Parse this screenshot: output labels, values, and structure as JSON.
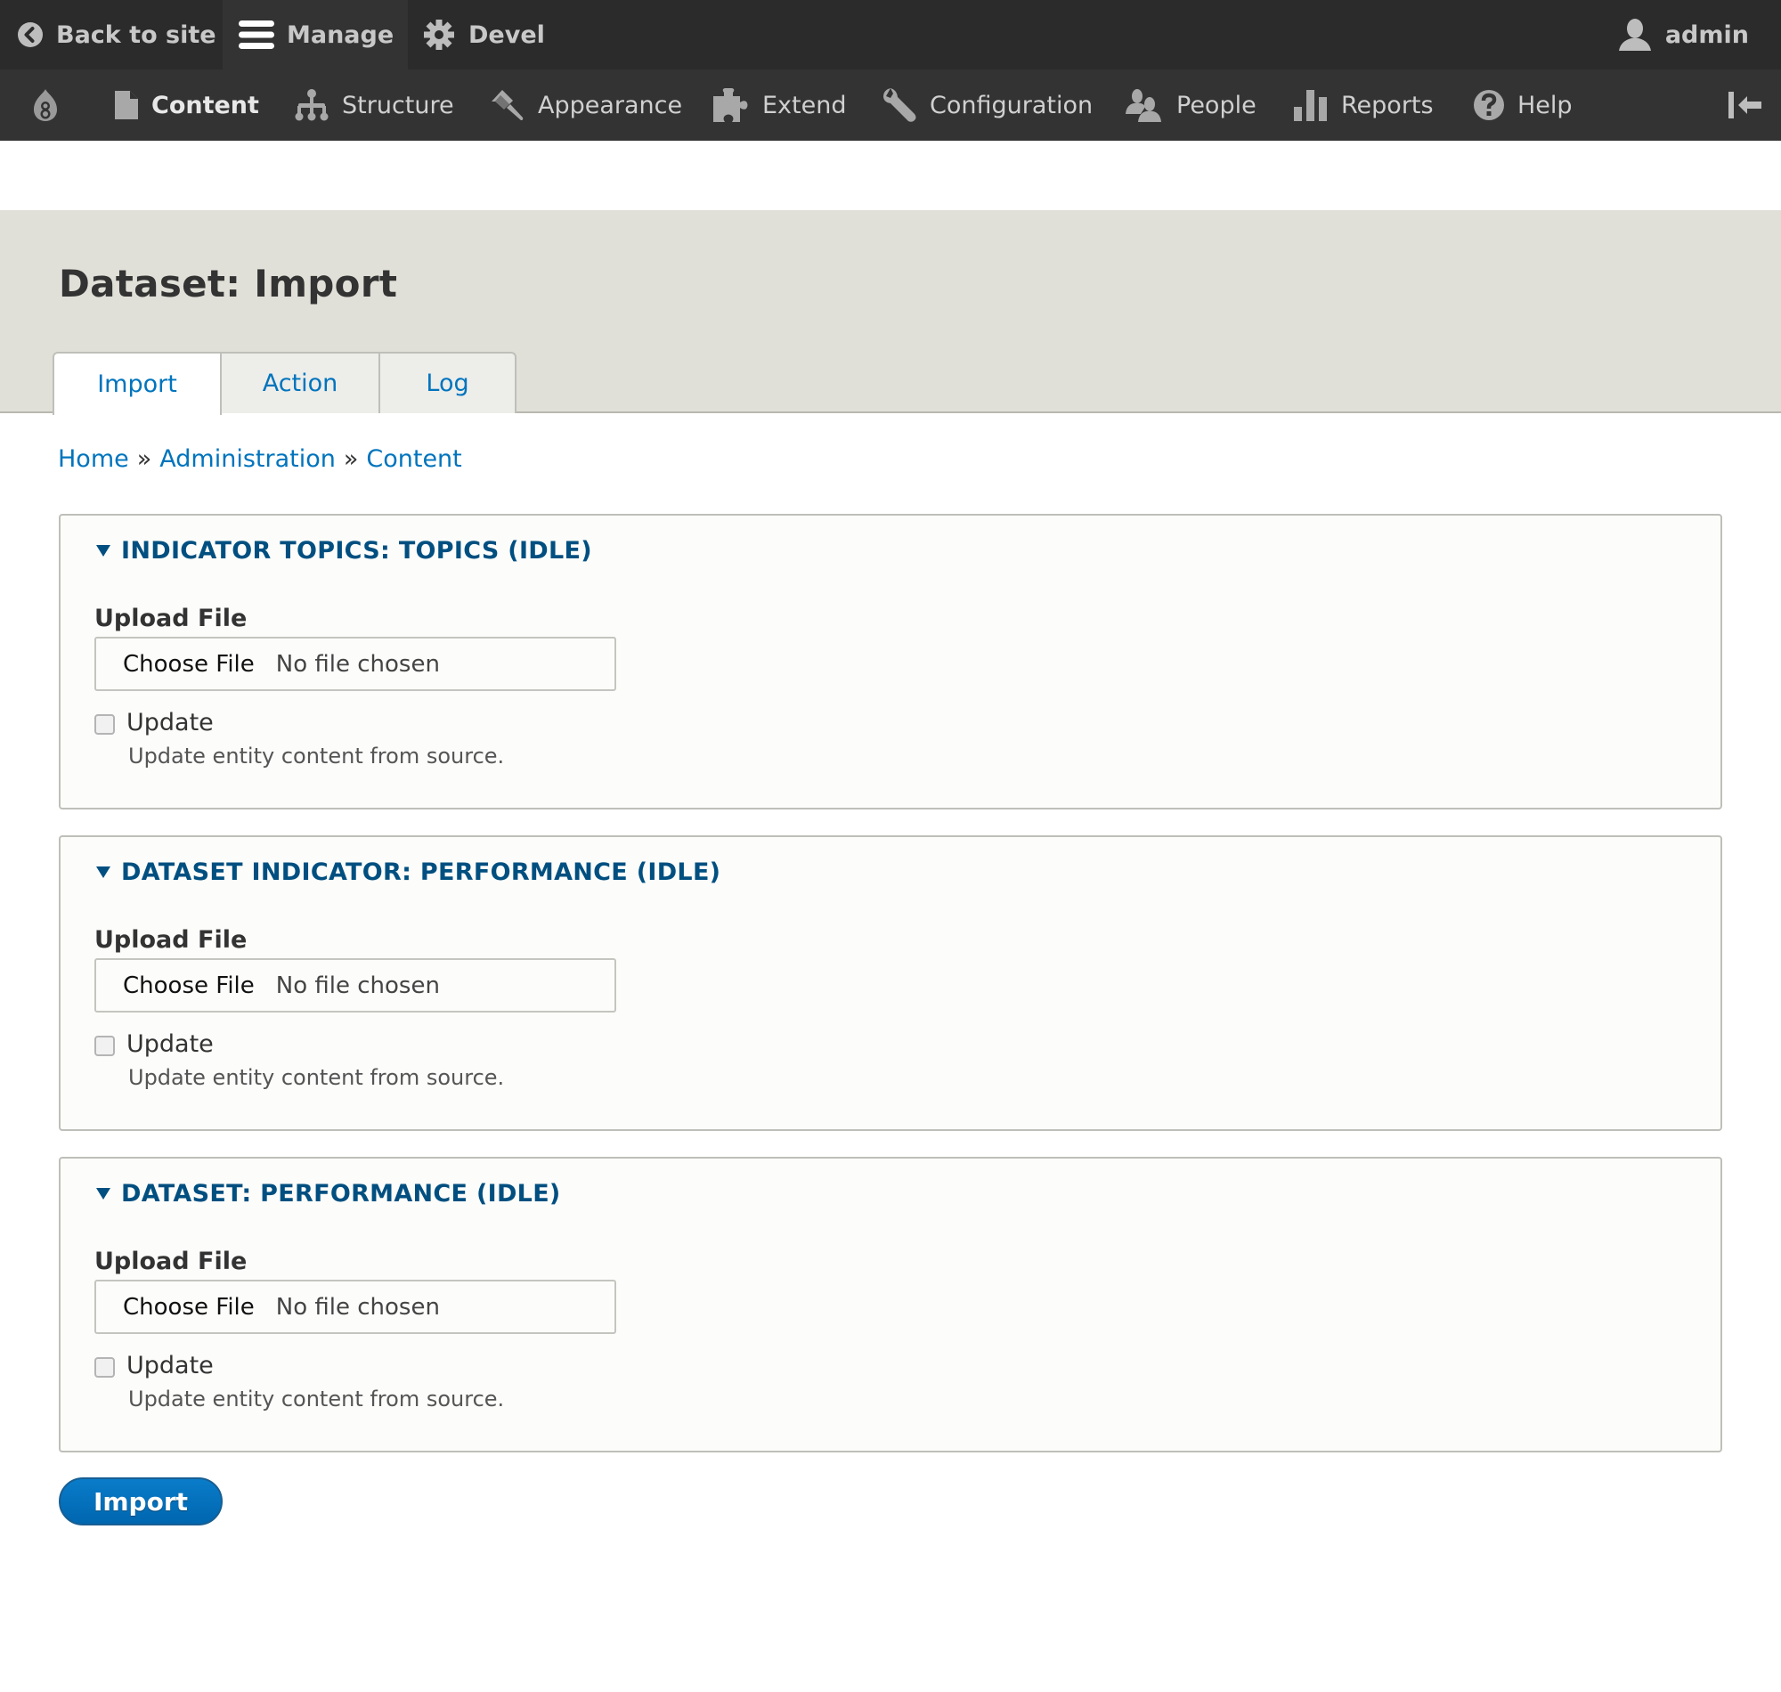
{
  "toolbar": {
    "back_label": "Back to site",
    "manage_label": "Manage",
    "devel_label": "Devel",
    "user_label": "admin"
  },
  "nav": {
    "items": [
      {
        "label": "Content",
        "icon": "file-icon",
        "active": true
      },
      {
        "label": "Structure",
        "icon": "sitemap-icon"
      },
      {
        "label": "Appearance",
        "icon": "paintbrush-icon"
      },
      {
        "label": "Extend",
        "icon": "puzzle-icon"
      },
      {
        "label": "Configuration",
        "icon": "wrench-icon"
      },
      {
        "label": "People",
        "icon": "people-icon"
      },
      {
        "label": "Reports",
        "icon": "bar-chart-icon"
      },
      {
        "label": "Help",
        "icon": "help-icon"
      }
    ]
  },
  "page": {
    "title": "Dataset: Import",
    "tabs": [
      {
        "label": "Import",
        "active": true
      },
      {
        "label": "Action"
      },
      {
        "label": "Log"
      }
    ],
    "breadcrumb": [
      {
        "label": "Home"
      },
      {
        "label": "Administration"
      },
      {
        "label": "Content"
      }
    ],
    "breadcrumb_separator": "»"
  },
  "fieldsets": [
    {
      "legend": "INDICATOR TOPICS: TOPICS (IDLE)",
      "upload_label": "Upload File",
      "file_button": "Choose File",
      "file_status": "No file chosen",
      "checkbox_label": "Update",
      "checkbox_checked": false,
      "description": "Update entity content from source."
    },
    {
      "legend": "DATASET INDICATOR: PERFORMANCE (IDLE)",
      "upload_label": "Upload File",
      "file_button": "Choose File",
      "file_status": "No file chosen",
      "checkbox_label": "Update",
      "checkbox_checked": false,
      "description": "Update entity content from source."
    },
    {
      "legend": "DATASET: PERFORMANCE (IDLE)",
      "upload_label": "Upload File",
      "file_button": "Choose File",
      "file_status": "No file chosen",
      "checkbox_label": "Update",
      "checkbox_checked": false,
      "description": "Update entity content from source."
    }
  ],
  "actions": {
    "submit_label": "Import"
  },
  "colors": {
    "link": "#0074bd",
    "legend": "#004f80",
    "primary_button": "#0071b8",
    "toolbar_bg": "#2b2b2b",
    "nav_bg": "#333333",
    "header_bg": "#e0e0d8"
  }
}
